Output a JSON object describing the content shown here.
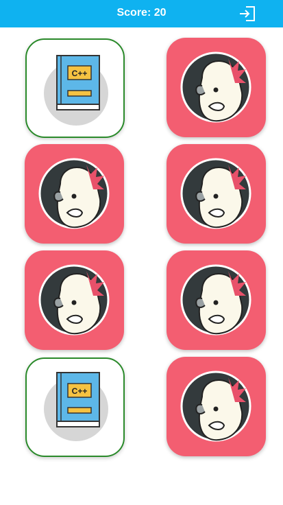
{
  "header": {
    "score_text": "Score: 20",
    "bar_color": "#0fb2f0",
    "exit_icon": "exit-icon"
  },
  "cards": [
    {
      "state": "face-up",
      "matched": true,
      "icon": "cpp-book-icon",
      "book_label": "C++"
    },
    {
      "state": "face-down",
      "icon": "penguin-icon"
    },
    {
      "state": "face-down",
      "icon": "penguin-icon"
    },
    {
      "state": "face-down",
      "icon": "penguin-icon"
    },
    {
      "state": "face-down",
      "icon": "penguin-icon"
    },
    {
      "state": "face-down",
      "icon": "penguin-icon"
    },
    {
      "state": "face-up",
      "matched": true,
      "icon": "cpp-book-icon",
      "book_label": "C++"
    },
    {
      "state": "face-down",
      "icon": "penguin-icon"
    }
  ],
  "colors": {
    "card_back": "#f35e71",
    "matched_border": "#2a8a2a",
    "book_cover": "#5db7e8",
    "book_label_bg": "#f5c242"
  }
}
